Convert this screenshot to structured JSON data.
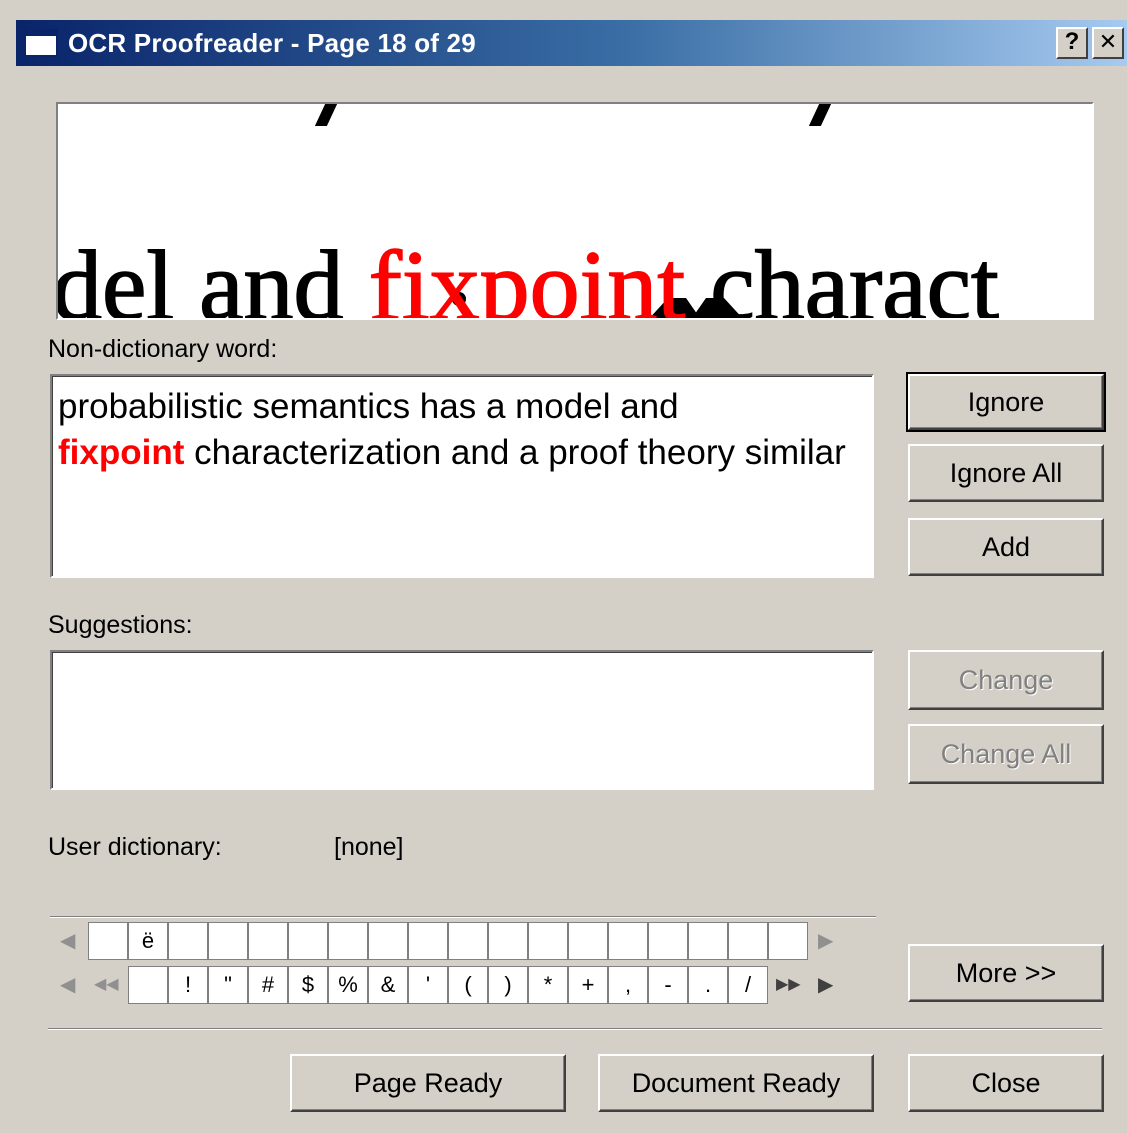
{
  "window": {
    "title": "OCR Proofreader - Page 18 of 29",
    "help_glyph": "?",
    "close_glyph": "✕",
    "title_gradient": [
      "#0a246a",
      "#a6caf0"
    ]
  },
  "ocr_image": {
    "before": "del and ",
    "word": "fixpoint",
    "after": " charact",
    "highlight_color": "#ff0000"
  },
  "nondict": {
    "label": "Non-dictionary word:",
    "text_before": "probabilistic semantics has a model and",
    "word": "fixpoint",
    "text_after": " characterization and a proof theory similar"
  },
  "suggestions": {
    "label": "Suggestions:",
    "items": []
  },
  "user_dictionary": {
    "label": "User dictionary:",
    "value": "[none]"
  },
  "buttons": {
    "ignore": "Ignore",
    "ignore_all": "Ignore All",
    "add": "Add",
    "change": "Change",
    "change_all": "Change All",
    "more": "More >>",
    "page_ready": "Page Ready",
    "document_ready": "Document Ready",
    "close": "Close"
  },
  "char_grid": {
    "row1": [
      "",
      "ë",
      "",
      "",
      "",
      "",
      "",
      "",
      "",
      "",
      "",
      "",
      "",
      "",
      "",
      "",
      "",
      ""
    ],
    "row2": [
      "",
      "!",
      "\"",
      "#",
      "$",
      "%",
      "&",
      "'",
      "(",
      ")",
      "*",
      "+",
      ",",
      "-",
      ".",
      "/"
    ],
    "arrows": {
      "left": "◀",
      "right": "▶",
      "first": "◀◀",
      "last": "▶▶"
    }
  }
}
